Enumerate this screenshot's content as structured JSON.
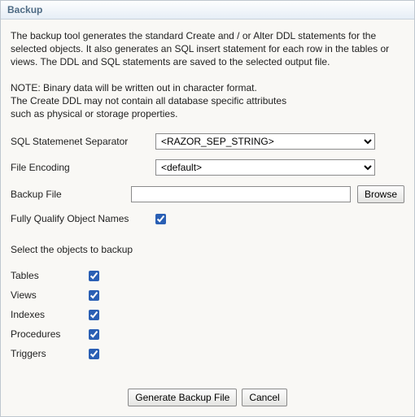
{
  "title": "Backup",
  "description": "The backup tool generates the standard Create and / or Alter DDL statements for the selected objects. It also generates an SQL insert statement for each row in the tables or views. The DDL and SQL statements are saved to the selected output file.",
  "noteLine1": "NOTE: Binary data will be written out in character format.",
  "noteLine2": "The Create DDL may not contain all database specific attributes",
  "noteLine3": "such as physical or storage properties.",
  "labels": {
    "separator": "SQL Statemenet Separator",
    "encoding": "File Encoding",
    "backupFile": "Backup File",
    "browse": "Browse",
    "fullyQualify": "Fully Qualify Object Names",
    "selectObjects": "Select the objects to backup",
    "generate": "Generate Backup File",
    "cancel": "Cancel"
  },
  "values": {
    "separator": "<RAZOR_SEP_STRING>",
    "encoding": "<default>",
    "backupFile": "",
    "fullyQualify": true
  },
  "objects": [
    {
      "label": "Tables",
      "checked": true
    },
    {
      "label": "Views",
      "checked": true
    },
    {
      "label": "Indexes",
      "checked": true
    },
    {
      "label": "Procedures",
      "checked": true
    },
    {
      "label": "Triggers",
      "checked": true
    }
  ]
}
